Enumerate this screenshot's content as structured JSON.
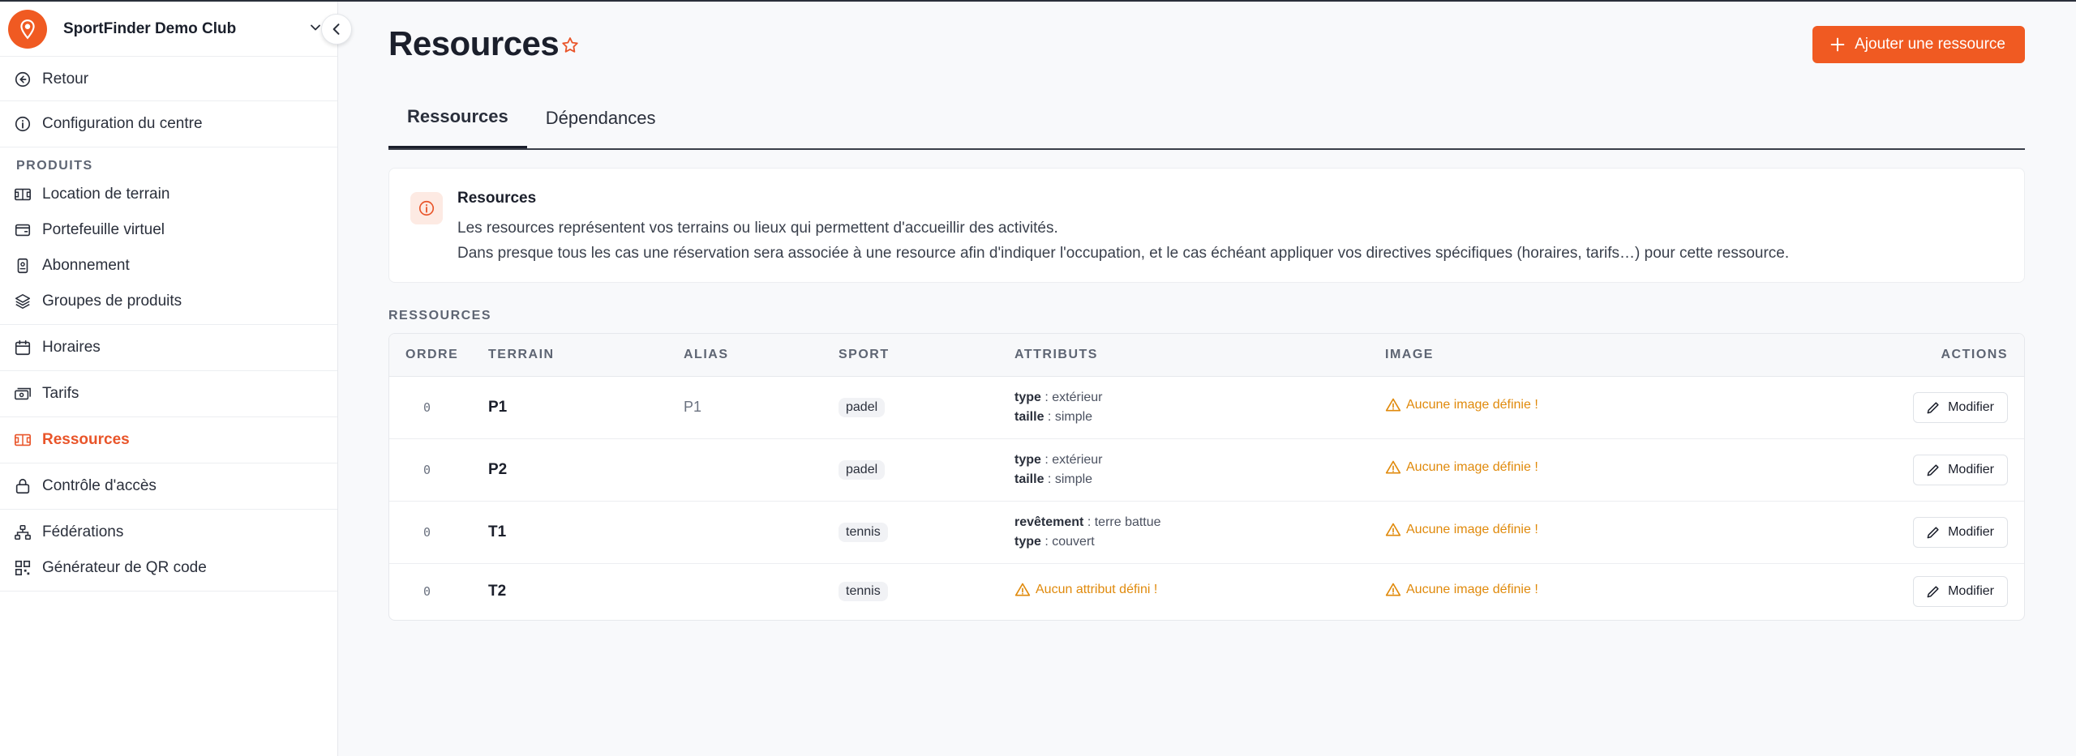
{
  "sidebar": {
    "club_name": "SportFinder Demo Club",
    "back_label": "Retour",
    "config_label": "Configuration du centre",
    "products_heading": "PRODUITS",
    "products": [
      {
        "label": "Location de terrain",
        "icon": "court-icon"
      },
      {
        "label": "Portefeuille virtuel",
        "icon": "wallet-icon"
      },
      {
        "label": "Abonnement",
        "icon": "badge-icon"
      },
      {
        "label": "Groupes de produits",
        "icon": "layers-icon"
      }
    ],
    "schedules_label": "Horaires",
    "rates_label": "Tarifs",
    "resources_label": "Ressources",
    "access_label": "Contrôle d'accès",
    "federations_label": "Fédérations",
    "qr_label": "Générateur de QR code"
  },
  "header": {
    "title": "Resources",
    "add_button": "Ajouter une ressource"
  },
  "tabs": [
    {
      "label": "Ressources",
      "active": true
    },
    {
      "label": "Dépendances",
      "active": false
    }
  ],
  "info": {
    "title": "Resources",
    "line1": "Les resources représentent vos terrains ou lieux qui permettent d'accueillir des activités.",
    "line2": "Dans presque tous les cas une réservation sera associée à une resource afin d'indiquer l'occupation, et le cas échéant appliquer vos directives spécifiques (horaires, tarifs…) pour cette ressource."
  },
  "table": {
    "section_label": "RESSOURCES",
    "columns": [
      "ORDRE",
      "TERRAIN",
      "ALIAS",
      "SPORT",
      "ATTRIBUTS",
      "IMAGE",
      "ACTIONS"
    ],
    "rows": [
      {
        "ordre": "0",
        "terrain": "P1",
        "alias": "P1",
        "sport": "padel",
        "attr1_key": "type",
        "attr1_val": "extérieur",
        "attr2_key": "taille",
        "attr2_val": "simple",
        "image": "Aucune image définie !",
        "action": "Modifier"
      },
      {
        "ordre": "0",
        "terrain": "P2",
        "alias": "",
        "sport": "padel",
        "attr1_key": "type",
        "attr1_val": "extérieur",
        "attr2_key": "taille",
        "attr2_val": "simple",
        "image": "Aucune image définie !",
        "action": "Modifier"
      },
      {
        "ordre": "0",
        "terrain": "T1",
        "alias": "",
        "sport": "tennis",
        "attr1_key": "revêtement",
        "attr1_val": "terre battue",
        "attr2_key": "type",
        "attr2_val": "couvert",
        "image": "Aucune image définie !",
        "action": "Modifier"
      },
      {
        "ordre": "0",
        "terrain": "T2",
        "alias": "",
        "sport": "tennis",
        "attr_warning": "Aucun attribut défini !",
        "image": "Aucune image définie !",
        "action": "Modifier"
      }
    ]
  },
  "colors": {
    "accent": "#f05a22",
    "warning": "#e08a0c"
  }
}
